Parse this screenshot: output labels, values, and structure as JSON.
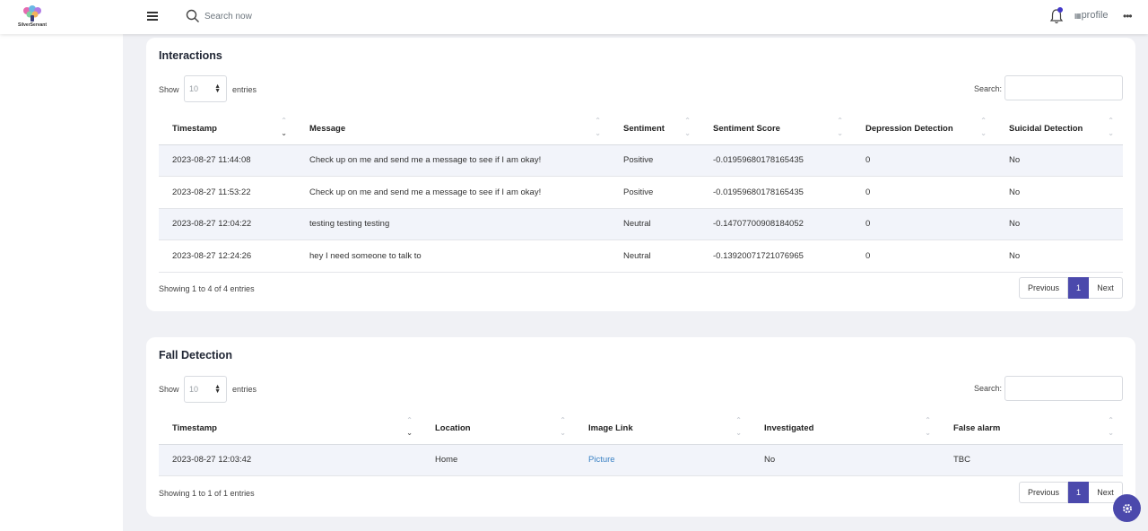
{
  "header": {
    "logo_text": "SilverServant",
    "search_placeholder": "Search now",
    "profile_alt": "profile",
    "more": "•••"
  },
  "interactions": {
    "title": "Interactions",
    "show_label": "Show",
    "page_size": "10",
    "entries_label": "entries",
    "search_label": "Search:",
    "columns": [
      "Timestamp",
      "Message",
      "Sentiment",
      "Sentiment Score",
      "Depression Detection",
      "Suicidal Detection"
    ],
    "rows": [
      [
        "2023-08-27 11:44:08",
        "Check up on me and send me a message to see if I am okay!",
        "Positive",
        "-0.01959680178165435",
        "0",
        "No"
      ],
      [
        "2023-08-27 11:53:22",
        "Check up on me and send me a message to see if I am okay!",
        "Positive",
        "-0.01959680178165435",
        "0",
        "No"
      ],
      [
        "2023-08-27 12:04:22",
        "testing testing testing",
        "Neutral",
        "-0.14707700908184052",
        "0",
        "No"
      ],
      [
        "2023-08-27 12:24:26",
        "hey I need someone to talk to",
        "Neutral",
        "-0.13920071721076965",
        "0",
        "No"
      ]
    ],
    "info": "Showing 1 to 4 of 4 entries",
    "prev": "Previous",
    "page": "1",
    "next": "Next"
  },
  "fall_detection": {
    "title": "Fall Detection",
    "show_label": "Show",
    "page_size": "10",
    "entries_label": "entries",
    "search_label": "Search:",
    "columns": [
      "Timestamp",
      "Location",
      "Image Link",
      "Investigated",
      "False alarm"
    ],
    "rows": [
      [
        "2023-08-27 12:03:42",
        "Home",
        "Picture",
        "No",
        "TBC"
      ]
    ],
    "info": "Showing 1 to 1 of 1 entries",
    "prev": "Previous",
    "page": "1",
    "next": "Next"
  },
  "colors": {
    "accent": "#4b49ac",
    "link": "#3b82c4",
    "background": "#f0f1f5"
  },
  "icons": [
    "menu-icon",
    "search-icon",
    "bell-icon",
    "more-icon",
    "settings-icon",
    "sort-icon"
  ]
}
